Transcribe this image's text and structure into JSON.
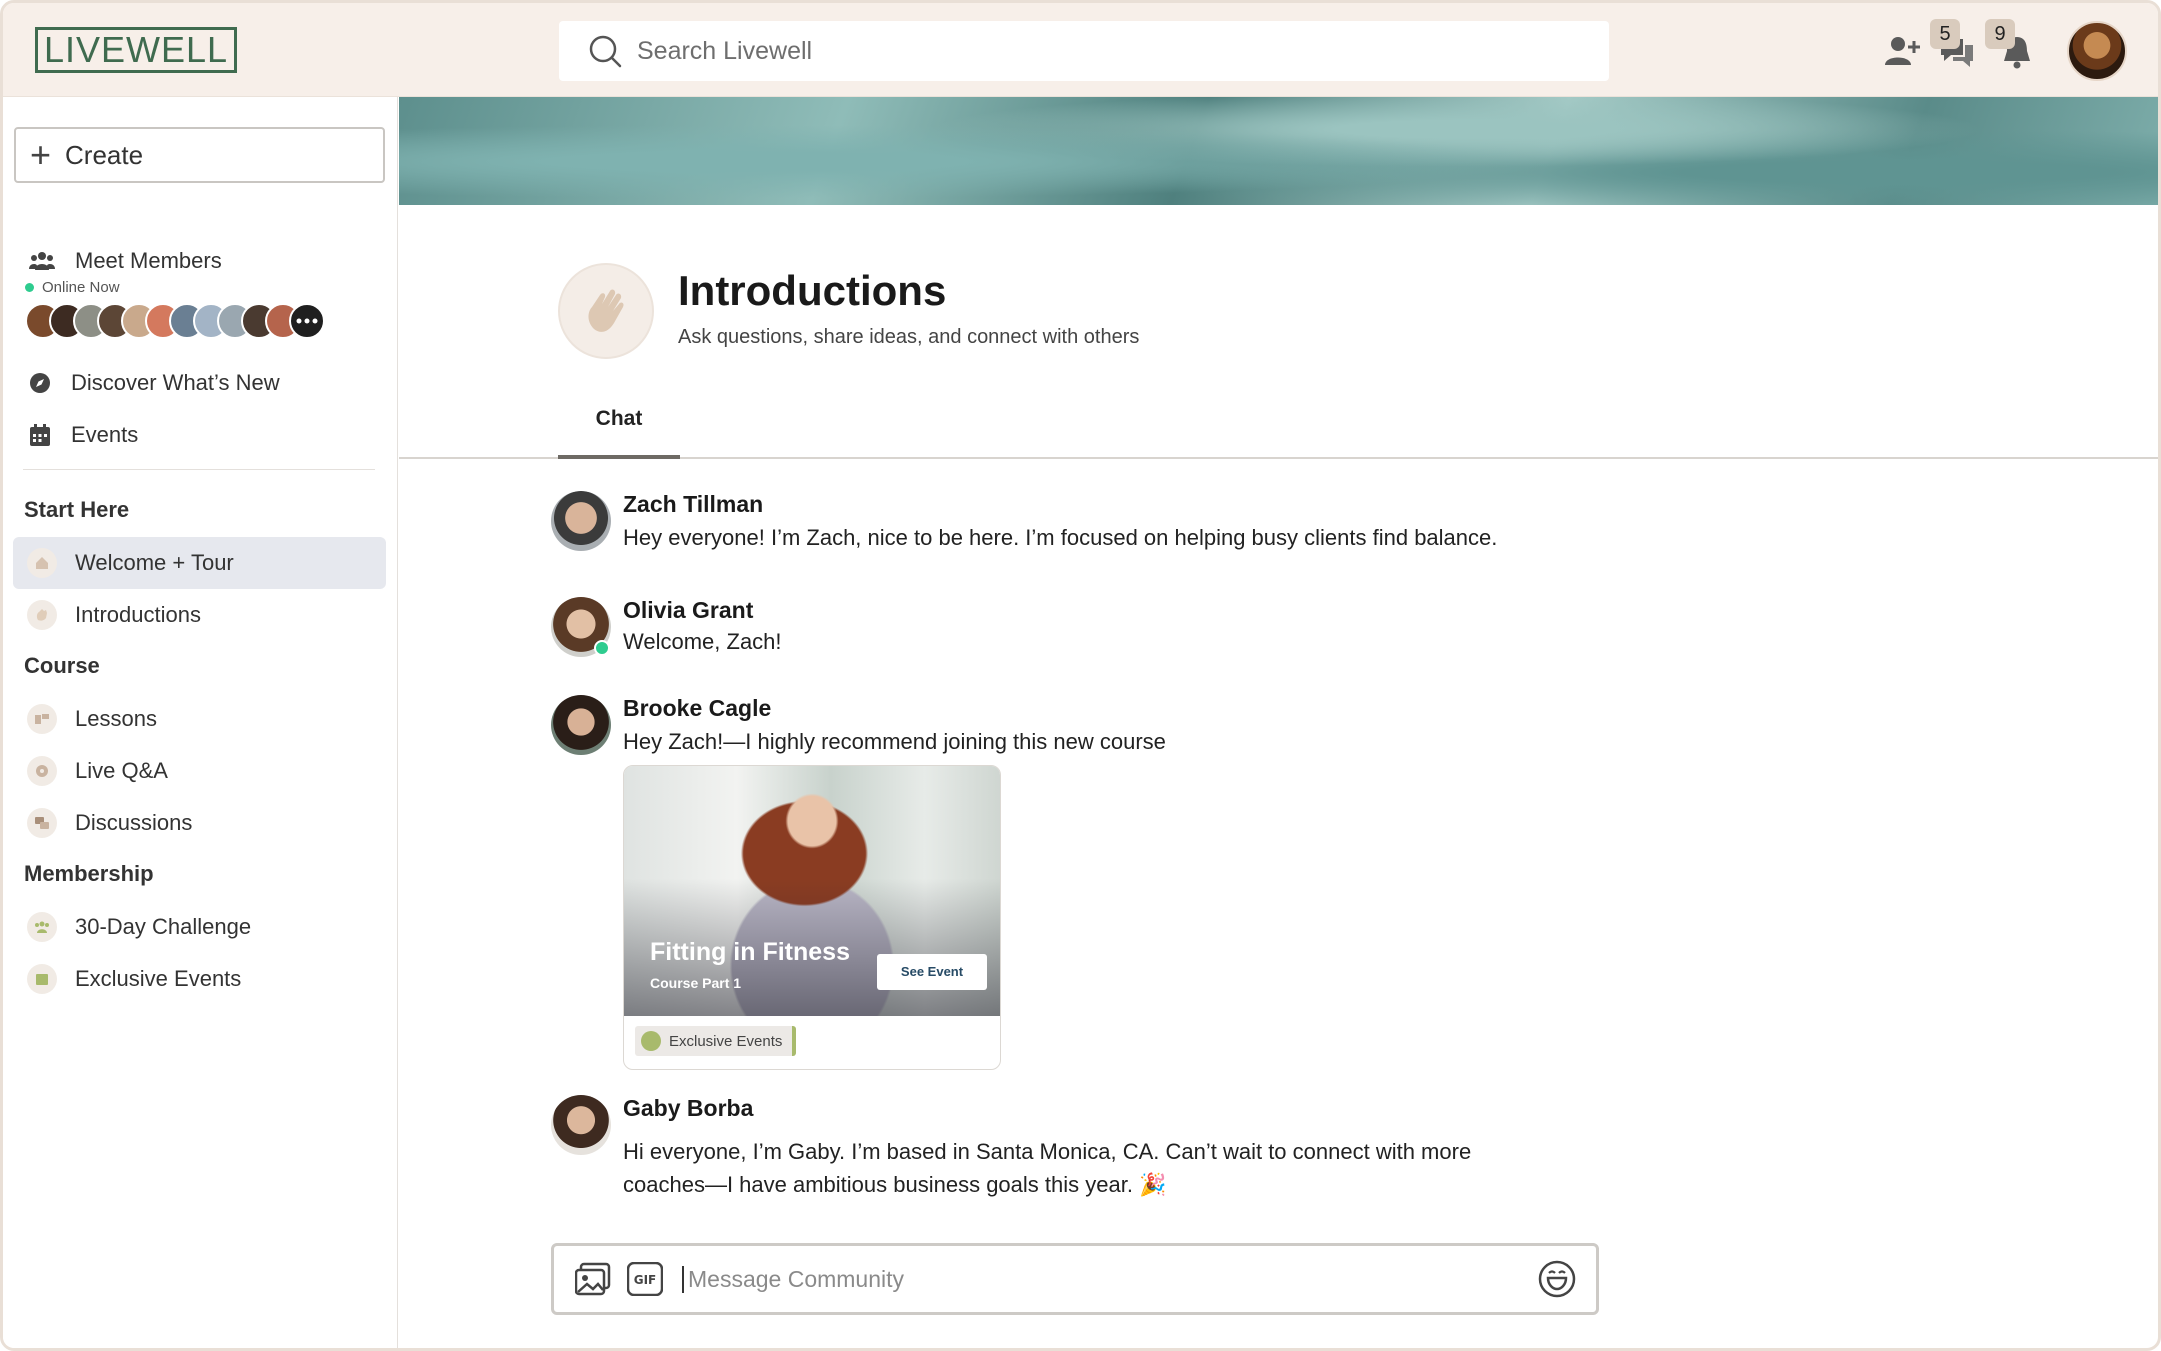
{
  "app": {
    "logo": "LIVEWELL"
  },
  "search": {
    "placeholder": "Search Livewell"
  },
  "header": {
    "messages_badge": "5",
    "notifications_badge": "9"
  },
  "sidebar": {
    "create_label": "Create",
    "meet_members": "Meet Members",
    "online_now": "Online Now",
    "discover": "Discover What’s New",
    "events": "Events",
    "sections": [
      {
        "title": "Start Here",
        "items": [
          "Welcome + Tour",
          "Introductions"
        ]
      },
      {
        "title": "Course",
        "items": [
          "Lessons",
          "Live Q&A",
          "Discussions"
        ]
      },
      {
        "title": "Membership",
        "items": [
          "30-Day Challenge",
          "Exclusive Events"
        ]
      }
    ]
  },
  "page": {
    "title": "Introductions",
    "subtitle": "Ask questions, share ideas, and connect with others",
    "tabs": [
      "Chat"
    ]
  },
  "messages": [
    {
      "name": "Zach Tillman",
      "lines": [
        "Hey everyone! I’m Zach, nice to be here. I’m focused on helping busy clients find balance."
      ]
    },
    {
      "name": "Olivia Grant",
      "lines": [
        "Welcome, Zach!"
      ]
    },
    {
      "name": "Brooke Cagle",
      "lines": [
        "Hey Zach!—I highly recommend joining this new course"
      ]
    },
    {
      "name": "Gaby Borba",
      "lines": [
        "Hi everyone, I’m Gaby. I’m based in Santa Monica, CA.  Can’t wait to connect with more",
        "coaches—I have ambitious business goals this year. 🎉"
      ]
    }
  ],
  "event_card": {
    "title": "Fitting in Fitness",
    "subtitle": "Course Part 1",
    "button": "See Event",
    "tag": "Exclusive Events"
  },
  "composer": {
    "placeholder": "Message Community",
    "gif_label": "GIF"
  }
}
